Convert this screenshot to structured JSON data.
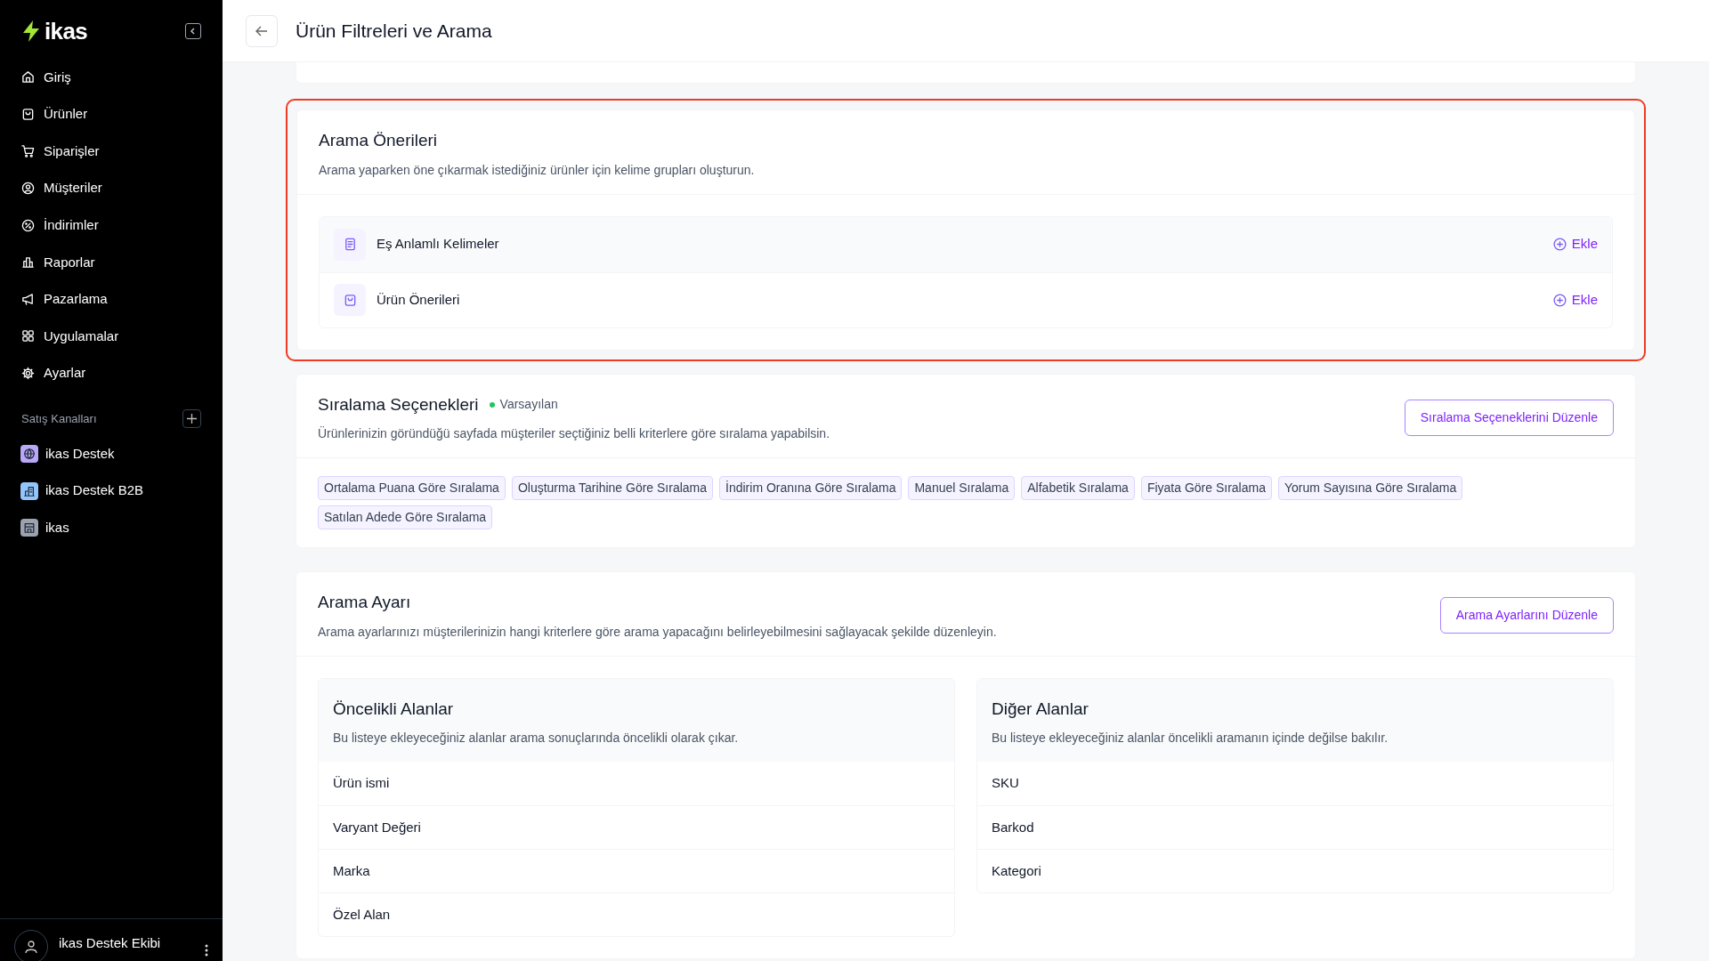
{
  "sidebar": {
    "logo": "ikas",
    "nav": [
      {
        "label": "Giriş"
      },
      {
        "label": "Ürünler"
      },
      {
        "label": "Siparişler"
      },
      {
        "label": "Müşteriler"
      },
      {
        "label": "İndirimler"
      },
      {
        "label": "Raporlar"
      },
      {
        "label": "Pazarlama"
      },
      {
        "label": "Uygulamalar"
      },
      {
        "label": "Ayarlar"
      }
    ],
    "section_title": "Satış Kanalları",
    "channels": [
      {
        "label": "ikas Destek",
        "color": "#b9a7f8"
      },
      {
        "label": "ikas Destek B2B",
        "color": "#93c5fd"
      },
      {
        "label": "ikas",
        "color": "#9ca3af"
      }
    ],
    "user": {
      "name": "ikas Destek Ekibi"
    }
  },
  "header": {
    "title": "Ürün Filtreleri ve Arama"
  },
  "suggestions": {
    "highlighted": true,
    "title": "Arama Önerileri",
    "description": "Arama yaparken öne çıkarmak istediğiniz ürünler için kelime grupları oluşturun.",
    "items": [
      {
        "label": "Eş Anlamlı Kelimeler",
        "action": "Ekle"
      },
      {
        "label": "Ürün Önerileri",
        "action": "Ekle"
      }
    ]
  },
  "sorting": {
    "title": "Sıralama Seçenekleri",
    "badge": {
      "label": "Varsayılan",
      "color": "#22c55e"
    },
    "description": "Ürünlerinizin göründüğü sayfada müşteriler seçtiğiniz belli kriterlere göre sıralama yapabilsin.",
    "button": "Sıralama Seçeneklerini Düzenle",
    "options": [
      "Ortalama Puana Göre Sıralama",
      "Oluşturma Tarihine Göre Sıralama",
      "İndirim Oranına Göre Sıralama",
      "Manuel Sıralama",
      "Alfabetik Sıralama",
      "Fiyata Göre Sıralama",
      "Yorum Sayısına Göre Sıralama",
      "Satılan Adede Göre Sıralama"
    ]
  },
  "search_settings": {
    "title": "Arama Ayarı",
    "description": "Arama ayarlarınızı müşterilerinizin hangi kriterlere göre arama yapacağını belirleyebilmesini sağlayacak şekilde düzenleyin.",
    "button": "Arama Ayarlarını Düzenle",
    "groups": [
      {
        "title": "Öncelikli Alanlar",
        "description": "Bu listeye ekleyeceğiniz alanlar arama sonuçlarında öncelikli olarak çıkar.",
        "fields": [
          "Ürün ismi",
          "Varyant Değeri",
          "Marka",
          "Özel Alan"
        ]
      },
      {
        "title": "Diğer Alanlar",
        "description": "Bu listeye ekleyeceğiniz alanlar öncelikli aramanın içinde değilse bakılır.",
        "fields": [
          "SKU",
          "Barkod",
          "Kategori"
        ]
      }
    ]
  }
}
